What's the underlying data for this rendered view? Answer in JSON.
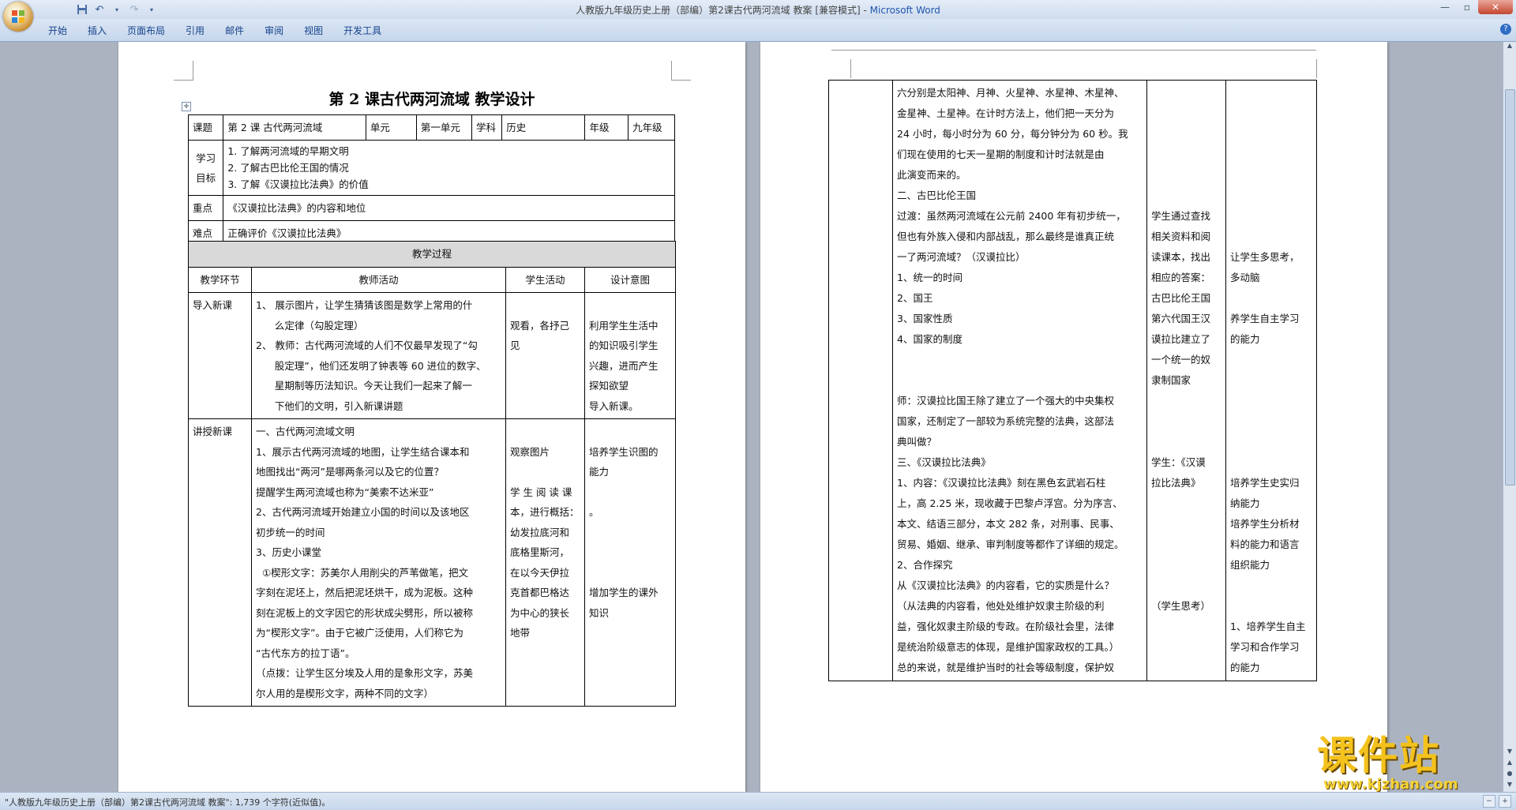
{
  "window": {
    "title_doc": "人教版九年级历史上册（部编）第2课古代两河流域 教案 [兼容模式] - ",
    "title_app": "Microsoft Word"
  },
  "ribbon": {
    "tabs": [
      "开始",
      "插入",
      "页面布局",
      "引用",
      "邮件",
      "审阅",
      "视图",
      "开发工具"
    ]
  },
  "doc": {
    "title": "第 2 课古代两河流域  教学设计",
    "info": {
      "label_lesson": "课题",
      "lesson": "第 2 课 古代两河流域",
      "label_unit": "单元",
      "unit": "第一单元",
      "label_subject": "学科",
      "subject": "历史",
      "label_grade": "年级",
      "grade": "九年级",
      "label_goal": "学习目标",
      "goals": [
        "1. 了解两河流域的早期文明",
        "2. 了解古巴比伦王国的情况",
        "3. 了解《汉谟拉比法典》的价值"
      ],
      "label_key": "重点",
      "key": "《汉谟拉比法典》的内容和地位",
      "label_difficulty": "难点",
      "difficulty": "正确评价《汉谟拉比法典》"
    },
    "process": {
      "heading": "教学过程",
      "columns": [
        "教学环节",
        "教师活动",
        "学生活动",
        "设计意图"
      ],
      "rows": [
        {
          "stage": "导入新课",
          "teacher": [
            "1、 展示图片，让学生猜猜该图是数学上常用的什",
            "      么定律（勾股定理）",
            "2、 教师：古代两河流域的人们不仅最早发现了“勾",
            "      股定理”，他们还发明了钟表等 60 进位的数字、",
            "      星期制等历法知识。今天让我们一起来了解一",
            "      下他们的文明，引入新课讲题"
          ],
          "student": [
            "",
            "观看，各抒己",
            "见"
          ],
          "design": [
            "",
            "利用学生生活中",
            "的知识吸引学生",
            "兴趣，进而产生",
            "探知欲望",
            "导入新课。"
          ]
        },
        {
          "stage": "讲授新课",
          "teacher": [
            "一、古代两河流域文明",
            "1、展示古代两河流域的地图，让学生结合课本和",
            "地图找出“两河”是哪两条河以及它的位置？",
            "提醒学生两河流域也称为“美索不达米亚”",
            "2、古代两河流域开始建立小国的时间以及该地区",
            "初步统一的时间",
            "3、历史小课堂",
            "  ①楔形文字：苏美尔人用削尖的芦苇做笔，把文",
            "字刻在泥坯上，然后把泥坯烘干，成为泥板。这种",
            "刻在泥板上的文字因它的形状成尖劈形，所以被称",
            "为“楔形文字”。由于它被广泛使用，人们称它为",
            "“古代东方的拉丁语”。",
            "（点拨：让学生区分埃及人用的是象形文字，苏美",
            "尔人用的是楔形文字，两种不同的文字）"
          ],
          "student": [
            "",
            "观察图片",
            "",
            "学 生 阅 读 课",
            "本，进行概括：",
            "幼发拉底河和",
            "底格里斯河，",
            "在以今天伊拉",
            "克首都巴格达",
            "为中心的狭长",
            "地带",
            "",
            "",
            ""
          ],
          "design": [
            "",
            "培养学生识图的",
            "能力",
            "",
            "。",
            "",
            "",
            "",
            "增加学生的课外",
            "知识",
            "",
            "",
            "",
            ""
          ]
        }
      ]
    },
    "right": {
      "teacher": [
        "六分别是太阳神、月神、火星神、水星神、木星神、",
        "金星神、土星神。在计时方法上，他们把一天分为",
        "24 小时，每小时分为 60 分，每分钟分为 60 秒。我",
        "们现在使用的七天一星期的制度和计时法就是由",
        "此演变而来的。",
        "二、古巴比伦王国",
        "过渡：虽然两河流域在公元前 2400 年有初步统一，",
        "但也有外族入侵和内部战乱，那么最终是谁真正统",
        "一了两河流域？（汉谟拉比）",
        "1、统一的时间",
        "2、国王",
        "3、国家性质",
        "4、国家的制度",
        "",
        "",
        "师：汉谟拉比国王除了建立了一个强大的中央集权",
        "国家，还制定了一部较为系统完整的法典，这部法",
        "典叫做？",
        "三、《汉谟拉比法典》",
        "1、内容：《汉谟拉比法典》刻在黑色玄武岩石柱",
        "上，高 2.25 米，现收藏于巴黎卢浮宫。分为序言、",
        "本文、结语三部分，本文 282 条，对刑事、民事、",
        "贸易、婚姻、继承、审判制度等都作了详细的规定。",
        "2、合作探究",
        "从《汉谟拉比法典》的内容看，它的实质是什么？",
        "（从法典的内容看，他处处维护奴隶主阶级的利",
        "益，强化奴隶主阶级的专政。在阶级社会里，法律",
        "是统治阶级意志的体现，是维护国家政权的工具。）",
        "总的来说，就是维护当时的社会等级制度，保护奴"
      ],
      "student": [
        "",
        "",
        "",
        "",
        "",
        "",
        "学生通过查找",
        "相关资料和阅",
        "读课本，找出",
        "相应的答案：",
        "古巴比伦王国",
        "第六代国王汉",
        "谟拉比建立了",
        "一个统一的奴",
        "隶制国家",
        "",
        "",
        "",
        "学生：《汉谟",
        "拉比法典》",
        "",
        "",
        "",
        "",
        "",
        "（学生思考）",
        "",
        "",
        ""
      ],
      "design": [
        "",
        "",
        "",
        "",
        "",
        "",
        "",
        "",
        "让学生多思考，",
        "多动脑",
        "",
        "养学生自主学习",
        "的能力",
        "",
        "",
        "",
        "",
        "",
        "",
        "培养学生史实归",
        "纳能力",
        "培养学生分析材",
        "料的能力和语言",
        "组织能力",
        "",
        "",
        "1、培养学生自主",
        "学习和合作学习",
        "的能力"
      ]
    }
  },
  "status": {
    "text": "\"人教版九年级历史上册（部编）第2课古代两河流域 教案\": 1,739 个字符(近似值)。"
  },
  "watermark": {
    "cn": "课件站",
    "url": "www.kjzhan.com"
  }
}
